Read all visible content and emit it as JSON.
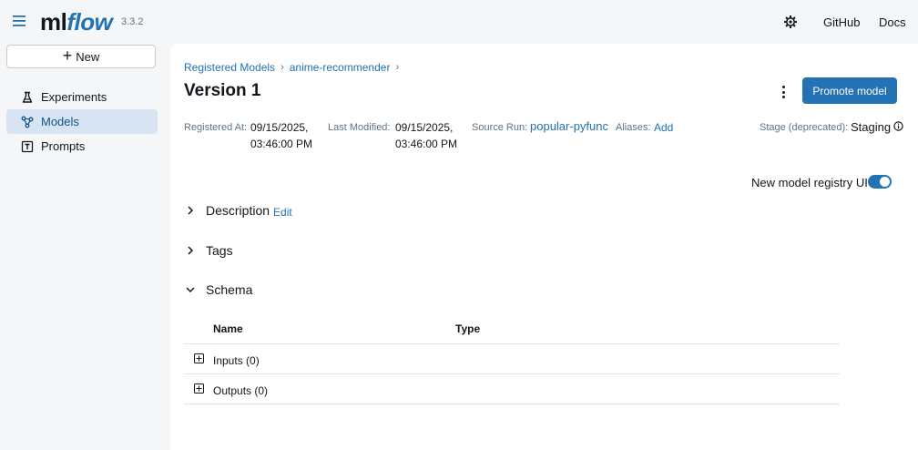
{
  "app": {
    "logo_ml": "ml",
    "logo_flow": "flow",
    "version": "3.3.2",
    "github": "GitHub",
    "docs": "Docs"
  },
  "sidebar": {
    "new_label": "New",
    "items": [
      {
        "label": "Experiments",
        "icon": "beaker-icon",
        "active": false
      },
      {
        "label": "Models",
        "icon": "models-icon",
        "active": true
      },
      {
        "label": "Prompts",
        "icon": "prompt-icon",
        "active": false
      }
    ]
  },
  "breadcrumb": [
    "Registered Models",
    "anime-recommender"
  ],
  "page": {
    "title": "Version 1",
    "promote_label": "Promote model"
  },
  "meta": {
    "registered_label": "Registered At:",
    "registered_value_line1": "09/15/2025,",
    "registered_value_line2": "03:46:00 PM",
    "modified_label": "Last Modified:",
    "modified_value_line1": "09/15/2025,",
    "modified_value_line2": "03:46:00 PM",
    "source_label": "Source Run:",
    "source_value": "popular-pyfunc",
    "aliases_label": "Aliases:",
    "aliases_add": "Add",
    "stage_label": "Stage (deprecated):",
    "stage_value": "Staging"
  },
  "toggle": {
    "label": "New model registry UI",
    "on": true
  },
  "sections": {
    "description": "Description",
    "description_edit": "Edit",
    "tags": "Tags",
    "schema": "Schema"
  },
  "schema": {
    "col_name": "Name",
    "col_type": "Type",
    "rows": [
      "Inputs (0)",
      "Outputs (0)"
    ]
  },
  "colors": {
    "accent": "#2272b4",
    "active_nav_bg": "#d7e5f2",
    "page_bg": "#f5f6f7"
  }
}
